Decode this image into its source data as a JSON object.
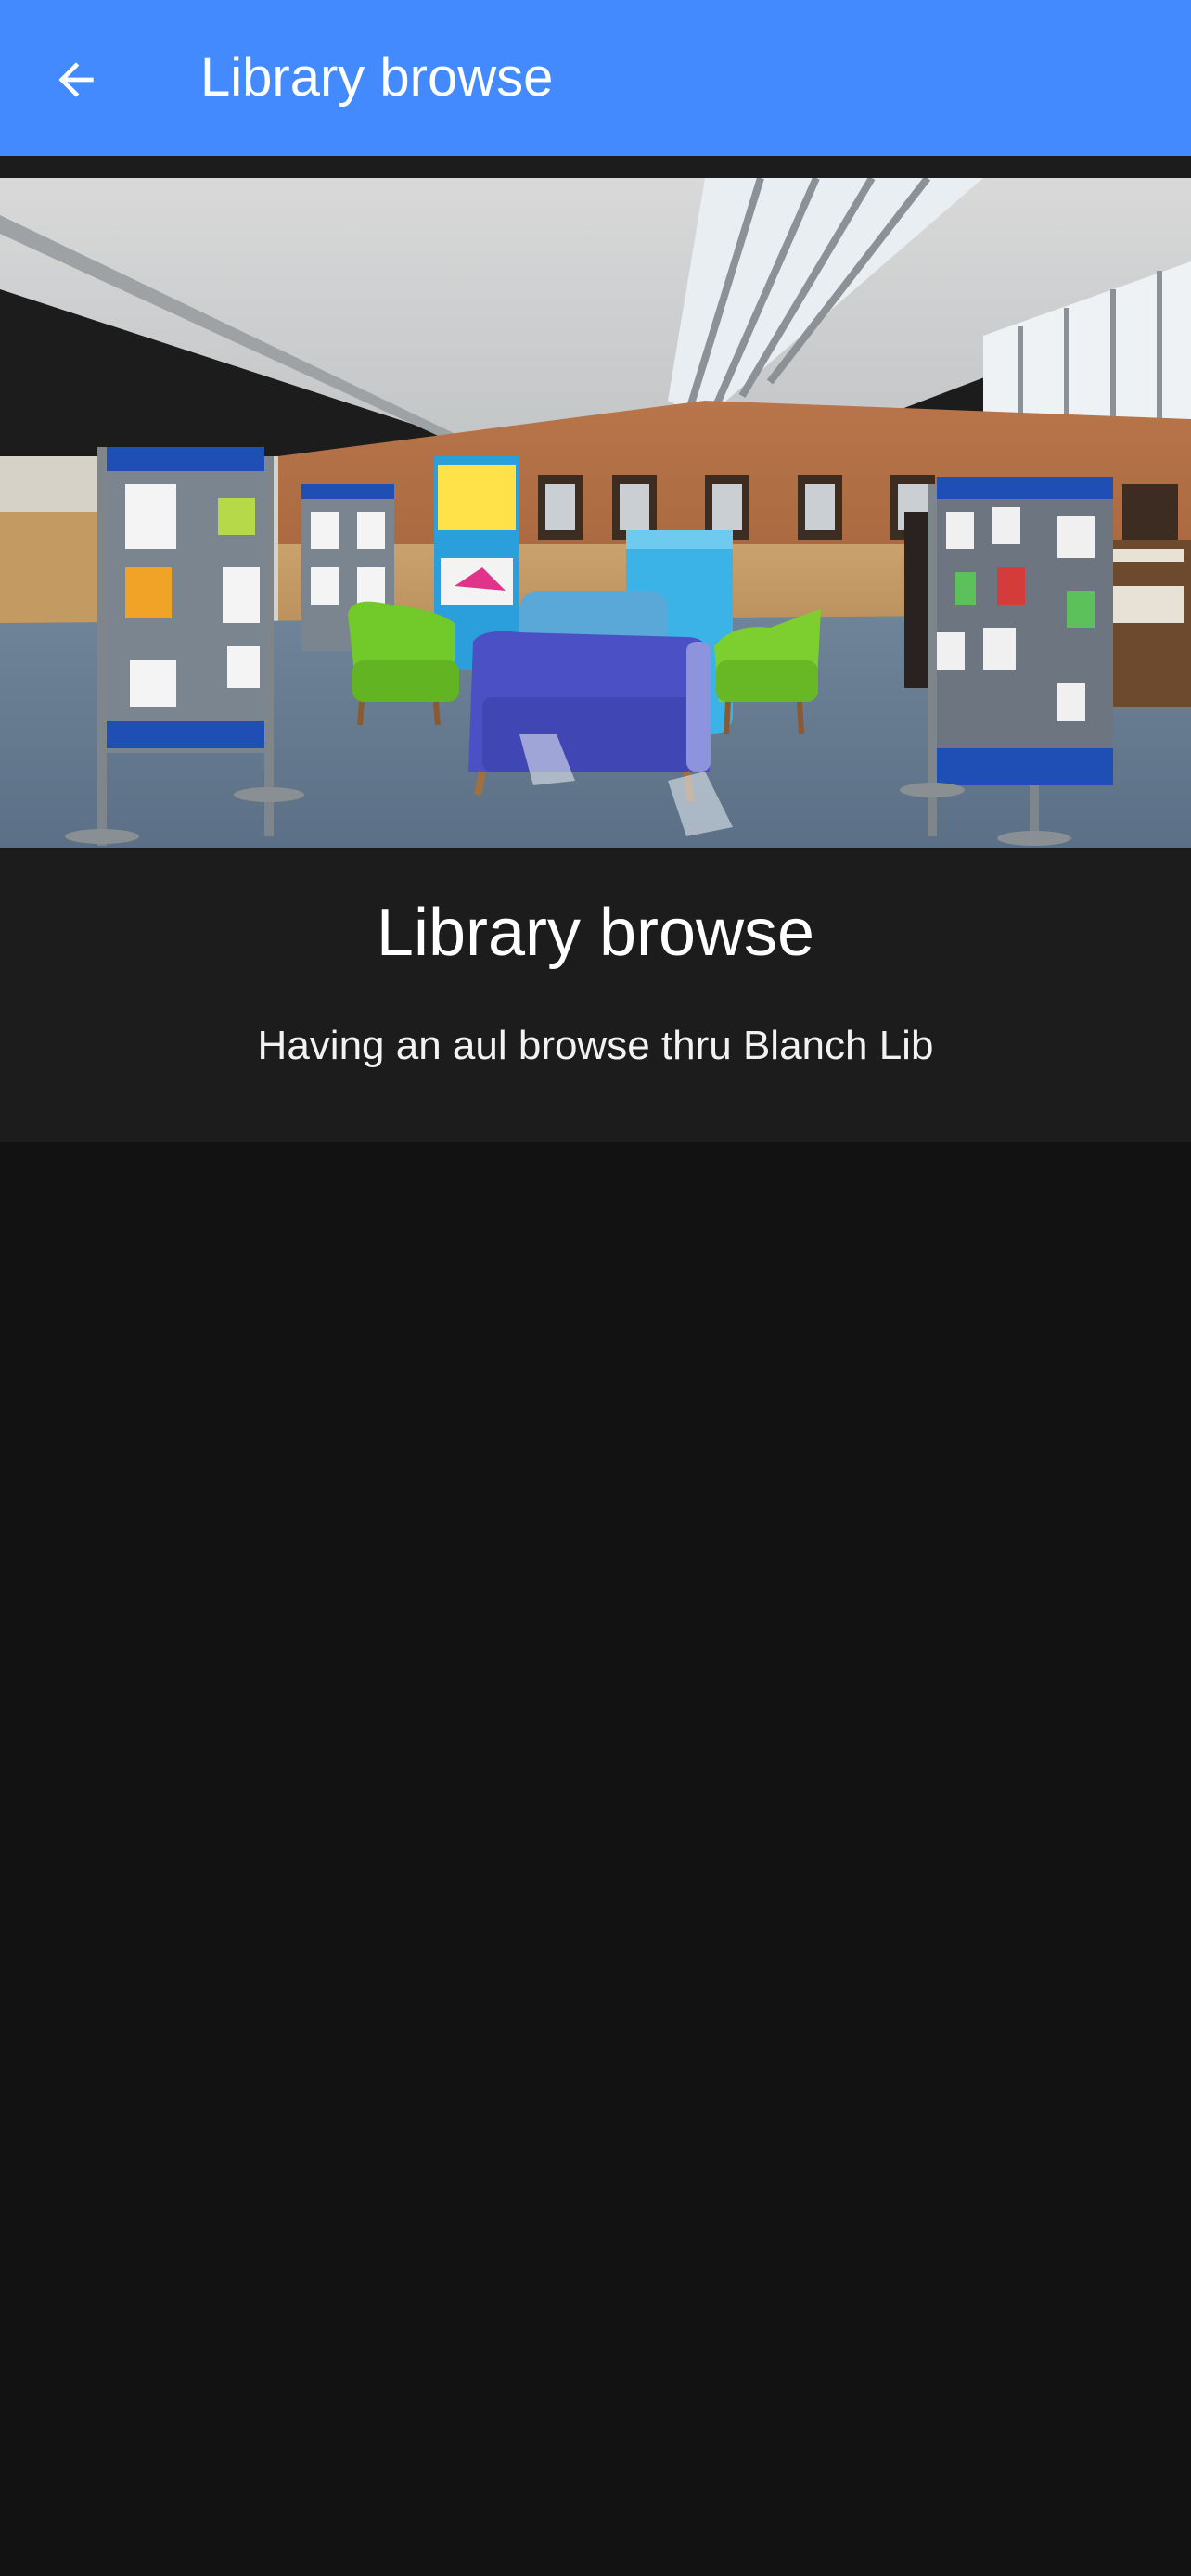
{
  "app_bar": {
    "title": "Library browse",
    "back_icon": "arrow-back-icon",
    "background_color": "#448aff"
  },
  "card": {
    "image_icon": "library-interior-photo",
    "title": "Library browse",
    "subtitle": "Having an aul browse thru Blanch Lib"
  }
}
